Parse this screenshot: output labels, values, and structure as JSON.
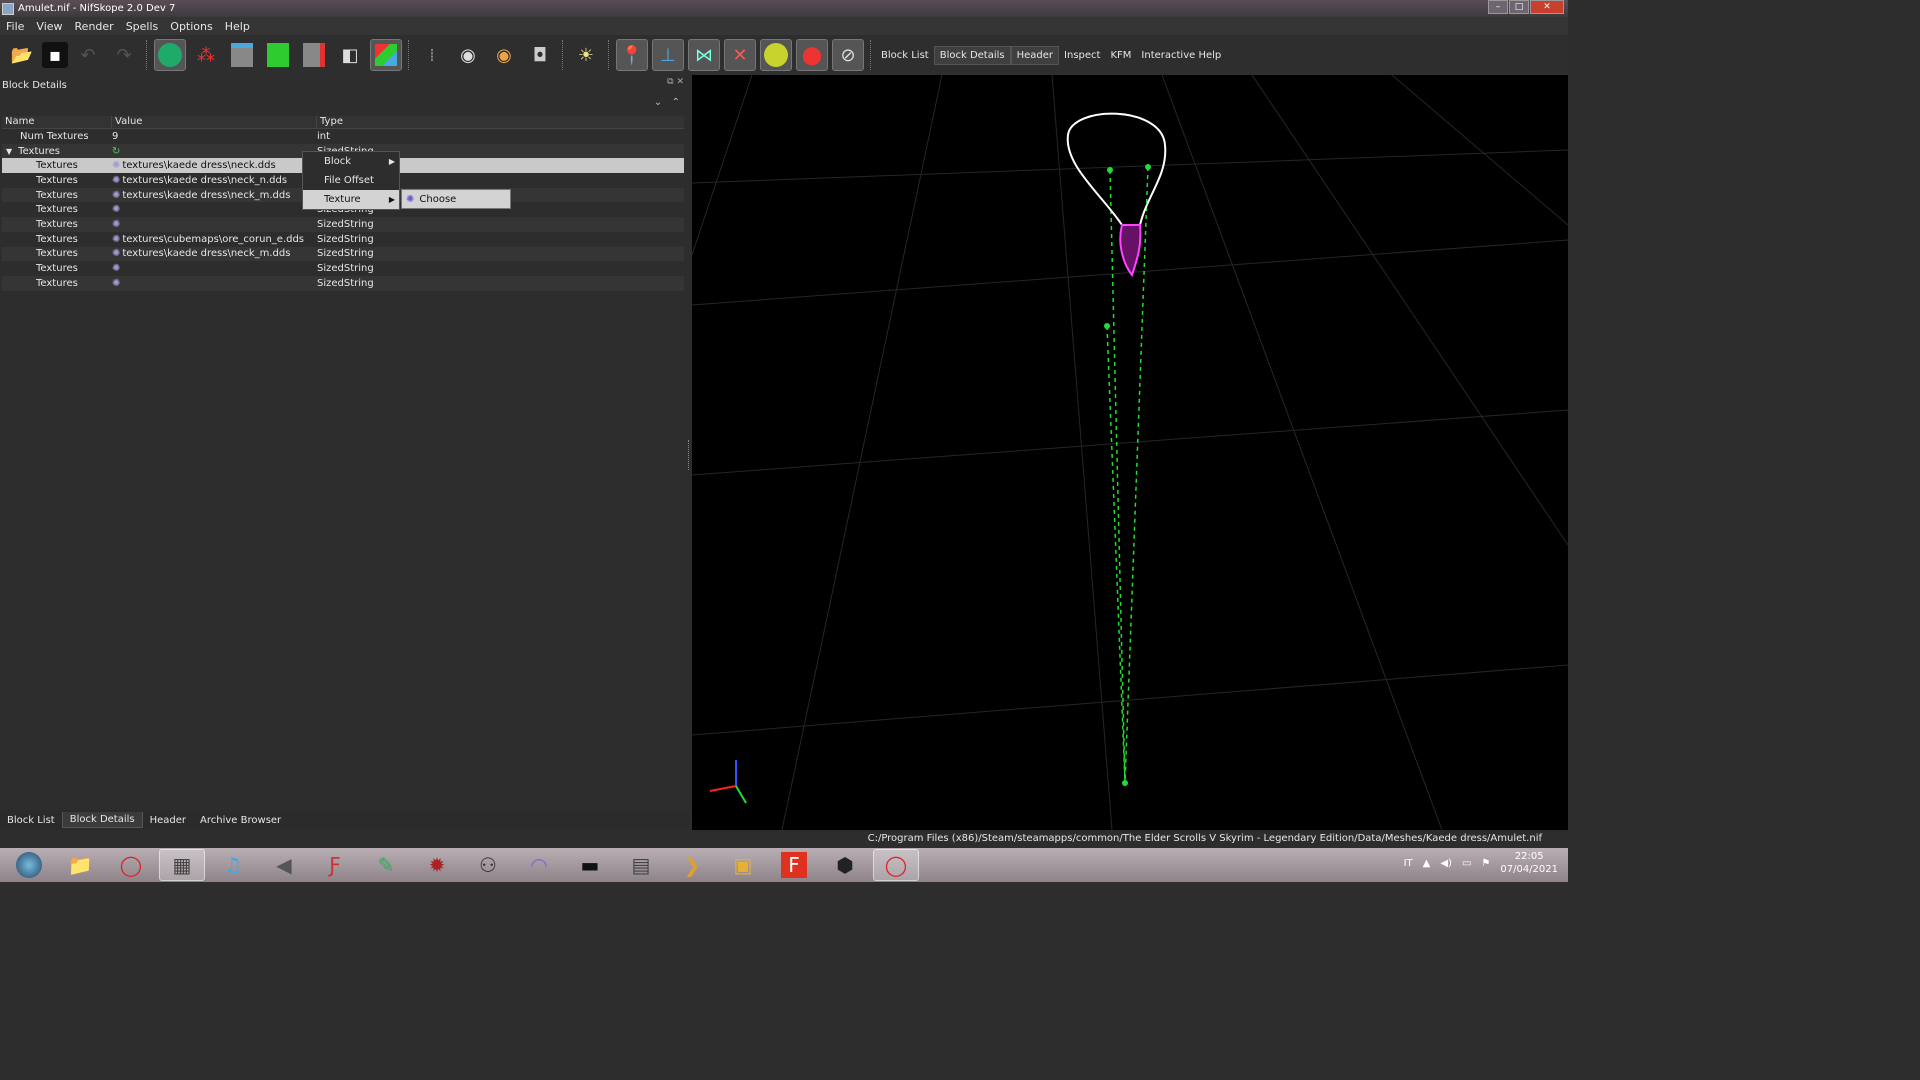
{
  "window": {
    "title": "Amulet.nif - NifSkope 2.0 Dev 7",
    "min": "–",
    "max": "□",
    "close": "✕"
  },
  "menu": [
    "File",
    "View",
    "Render",
    "Spells",
    "Options",
    "Help"
  ],
  "toolbar": {
    "icons": [
      "open-icon",
      "save-icon",
      "undo-icon",
      "redo-icon",
      "select-icon",
      "select-node-icon",
      "view-top-icon",
      "view-front-icon",
      "view-side-icon",
      "view-user-icon",
      "view-walk-icon",
      "footsteps-icon",
      "eye-icon",
      "eye-hidden-icon",
      "screenshot-icon",
      "light-icon",
      "marker-icon",
      "axes-icon",
      "nodes-icon",
      "havok-icon",
      "furniture-icon",
      "constraint-icon",
      "hide-icon"
    ],
    "dock_labels": [
      "Block List",
      "Block Details",
      "Header",
      "Inspect",
      "KFM",
      "Interactive Help"
    ],
    "active_dock": "Block Details"
  },
  "panel": {
    "title": "Block Details",
    "columns": [
      "Name",
      "Value",
      "Type"
    ],
    "rows": [
      {
        "name": "Num Textures",
        "value": "9",
        "type": "int"
      },
      {
        "name": "Textures",
        "value": "",
        "type": "SizedString"
      },
      {
        "name": "Textures",
        "value": "textures\\kaede dress\\neck.dds",
        "type": "SizedString"
      },
      {
        "name": "Textures",
        "value": "textures\\kaede dress\\neck_n.dds",
        "type": "SizedString"
      },
      {
        "name": "Textures",
        "value": "textures\\kaede dress\\neck_m.dds",
        "type": "SizedString"
      },
      {
        "name": "Textures",
        "value": "",
        "type": "SizedString"
      },
      {
        "name": "Textures",
        "value": "",
        "type": "SizedString"
      },
      {
        "name": "Textures",
        "value": "textures\\cubemaps\\ore_corun_e.dds",
        "type": "SizedString"
      },
      {
        "name": "Textures",
        "value": "textures\\kaede dress\\neck_m.dds",
        "type": "SizedString"
      },
      {
        "name": "Textures",
        "value": "",
        "type": "SizedString"
      },
      {
        "name": "Textures",
        "value": "",
        "type": "SizedString"
      }
    ]
  },
  "context_menu": {
    "items": [
      "Block",
      "File Offset",
      "Texture"
    ],
    "submenu_item": "Choose"
  },
  "bottom_tabs": [
    "Block List",
    "Block Details",
    "Header",
    "Archive Browser"
  ],
  "active_bottom_tab": "Block Details",
  "status": {
    "path": "C:/Program Files (x86)/Steam/steamapps/common/The Elder Scrolls V Skyrim - Legendary Edition/Data/Meshes/Kaede dress/Amulet.nif"
  },
  "taskbar": {
    "apps": [
      "start-icon",
      "explorer-icon",
      "opera-icon",
      "device-icon",
      "music-icon",
      "speaker-icon",
      "ffdec-icon",
      "pen-icon",
      "spider-icon",
      "people-icon",
      "headphones-icon",
      "nmm-icon",
      "window-icon",
      "arrow-icon",
      "archive-icon",
      "f-icon",
      "creation-kit-icon",
      "opera-red-icon"
    ],
    "lang": "IT",
    "time": "22:05",
    "date": "07/04/2021"
  },
  "colors": {
    "accent_green": "#22dd33",
    "mesh_pink": "#ff44ff",
    "grid": "#2a2a2a"
  }
}
